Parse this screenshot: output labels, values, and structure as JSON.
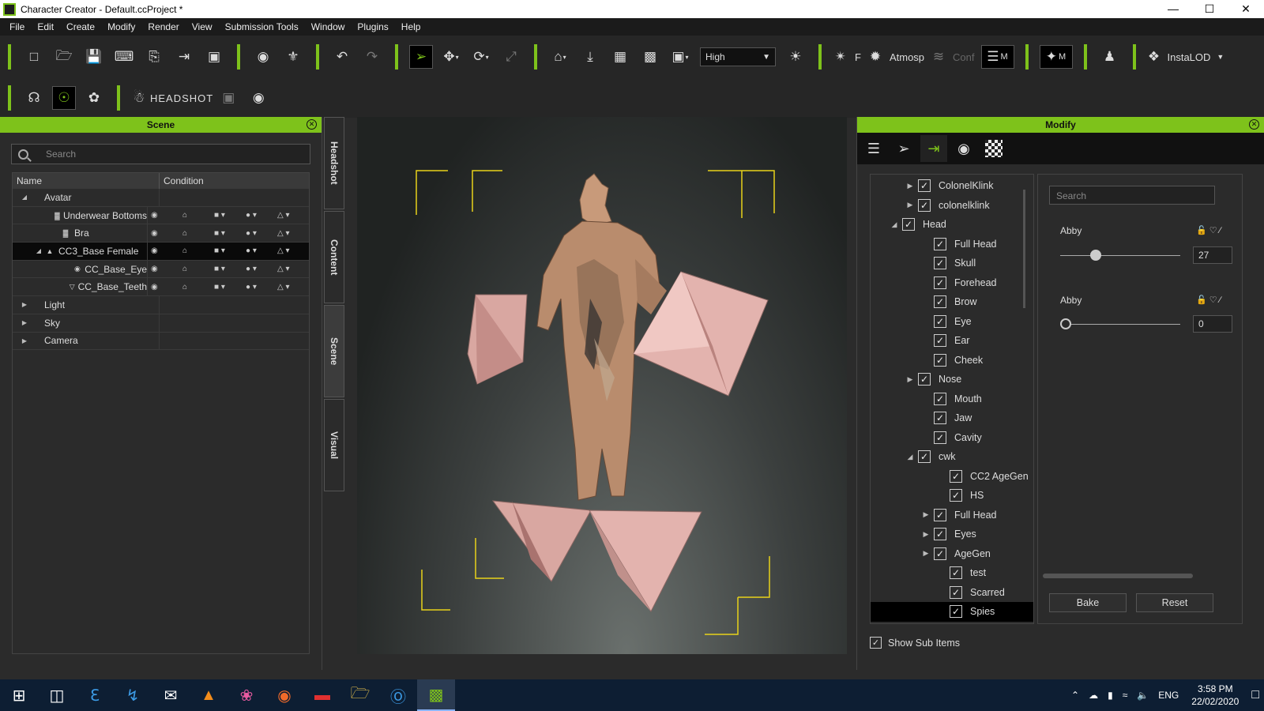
{
  "window": {
    "title": "Character Creator - Default.ccProject *",
    "min": "—",
    "max": "☐",
    "close": "✕"
  },
  "menu": [
    "File",
    "Edit",
    "Create",
    "Modify",
    "Render",
    "View",
    "Submission Tools",
    "Window",
    "Plugins",
    "Help"
  ],
  "toolbar": {
    "quality": "High",
    "f_label": "F",
    "atmos_label": "Atmosp",
    "conf_label": "Conf",
    "m1_label": "M",
    "m2_label": "M",
    "instalod_label": "InstaLOD",
    "headshot_label": "HEADSHOT"
  },
  "scene": {
    "title": "Scene",
    "search_placeholder": "Search",
    "col_name": "Name",
    "col_condition": "Condition",
    "rows": [
      {
        "label": "Avatar",
        "arrow": "◢",
        "icon": ""
      },
      {
        "label": "Underwear Bottoms",
        "arrow": "",
        "icon": "▓"
      },
      {
        "label": "Bra",
        "arrow": "",
        "icon": "▓"
      },
      {
        "label": "CC3_Base Female",
        "arrow": "◢",
        "icon": "▲"
      },
      {
        "label": "CC_Base_Eye",
        "arrow": "",
        "icon": "◉"
      },
      {
        "label": "CC_Base_Teeth",
        "arrow": "",
        "icon": "▽"
      },
      {
        "label": "Light",
        "arrow": "▶",
        "icon": ""
      },
      {
        "label": "Sky",
        "arrow": "▶",
        "icon": ""
      },
      {
        "label": "Camera",
        "arrow": "▶",
        "icon": ""
      }
    ]
  },
  "side_tabs": [
    "Headshot",
    "Content",
    "Scene",
    "Visual"
  ],
  "modify": {
    "title": "Modify",
    "search_placeholder": "Search",
    "tree": [
      {
        "label": "ColonelKlink",
        "arrow": "▶"
      },
      {
        "label": "colonelklink",
        "arrow": "▶"
      },
      {
        "label": "Head",
        "arrow": "◢"
      },
      {
        "label": "Full Head",
        "arrow": ""
      },
      {
        "label": "Skull",
        "arrow": ""
      },
      {
        "label": "Forehead",
        "arrow": ""
      },
      {
        "label": "Brow",
        "arrow": ""
      },
      {
        "label": "Eye",
        "arrow": ""
      },
      {
        "label": "Ear",
        "arrow": ""
      },
      {
        "label": "Cheek",
        "arrow": ""
      },
      {
        "label": "Nose",
        "arrow": "▶"
      },
      {
        "label": "Mouth",
        "arrow": ""
      },
      {
        "label": "Jaw",
        "arrow": ""
      },
      {
        "label": "Cavity",
        "arrow": ""
      },
      {
        "label": "cwk",
        "arrow": "◢"
      },
      {
        "label": "CC2 AgeGen",
        "arrow": ""
      },
      {
        "label": "HS",
        "arrow": ""
      },
      {
        "label": "Full Head",
        "arrow": "▶"
      },
      {
        "label": "Eyes",
        "arrow": "▶"
      },
      {
        "label": "AgeGen",
        "arrow": "▶"
      },
      {
        "label": "test",
        "arrow": ""
      },
      {
        "label": "Scarred",
        "arrow": ""
      },
      {
        "label": "Spies",
        "arrow": ""
      }
    ],
    "slider1": {
      "label": "Abby",
      "value": "27",
      "level": 0.27
    },
    "slider2": {
      "label": "Abby",
      "value": "0",
      "level": 0
    },
    "bake": "Bake",
    "reset": "Reset",
    "show_sub": "Show Sub Items"
  },
  "taskbar": {
    "lang": "ENG",
    "time": "3:58 PM",
    "date": "22/02/2020"
  },
  "colors": {
    "accent": "#7ec21b",
    "guide": "#e8d21a",
    "skin": "#c89a7a",
    "pink": "#e3b3ae"
  }
}
